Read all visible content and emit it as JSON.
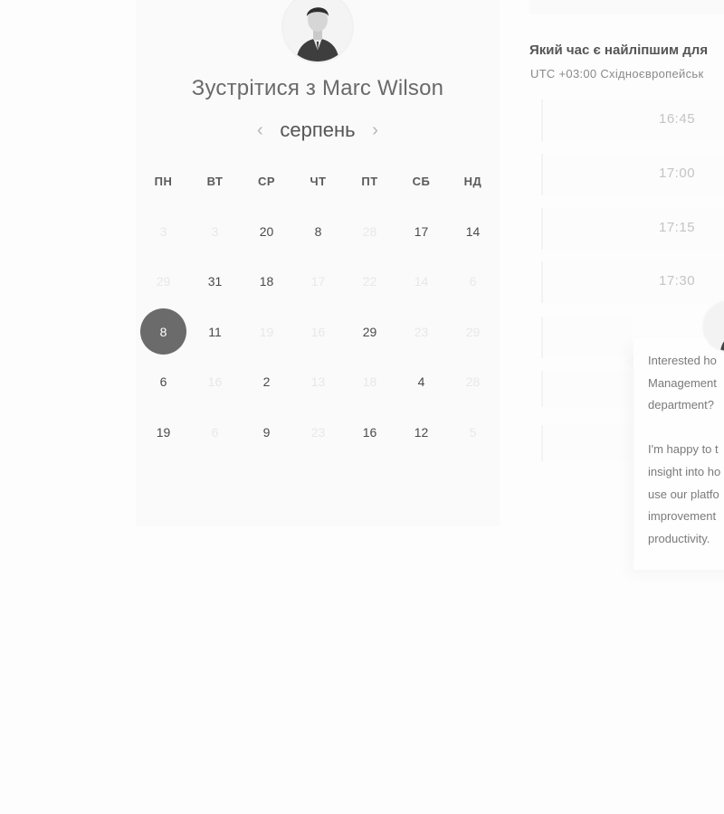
{
  "host": {
    "title": "Зустрітися з Marc Wilson"
  },
  "calendar": {
    "month": "серпень",
    "weekdays": [
      "ПН",
      "ВТ",
      "СР",
      "ЧТ",
      "ПТ",
      "СБ",
      "НД"
    ],
    "rows": [
      [
        {
          "d": "3",
          "s": "dim"
        },
        {
          "d": "3",
          "s": "dim"
        },
        {
          "d": "20",
          "s": "on"
        },
        {
          "d": "8",
          "s": "on"
        },
        {
          "d": "28",
          "s": "dim"
        },
        {
          "d": "17",
          "s": "on"
        },
        {
          "d": "14",
          "s": "on"
        }
      ],
      [
        {
          "d": "29",
          "s": "dim"
        },
        {
          "d": "31",
          "s": "on"
        },
        {
          "d": "18",
          "s": "on"
        },
        {
          "d": "17",
          "s": "dim"
        },
        {
          "d": "22",
          "s": "dim"
        },
        {
          "d": "14",
          "s": "dim"
        },
        {
          "d": "6",
          "s": "dim"
        }
      ],
      [
        {
          "d": "8",
          "s": "sel"
        },
        {
          "d": "11",
          "s": "on"
        },
        {
          "d": "19",
          "s": "dim"
        },
        {
          "d": "16",
          "s": "dim"
        },
        {
          "d": "29",
          "s": "on"
        },
        {
          "d": "23",
          "s": "dim"
        },
        {
          "d": "29",
          "s": "dim"
        }
      ],
      [
        {
          "d": "6",
          "s": "on"
        },
        {
          "d": "16",
          "s": "dim"
        },
        {
          "d": "2",
          "s": "on"
        },
        {
          "d": "13",
          "s": "dim"
        },
        {
          "d": "18",
          "s": "dim"
        },
        {
          "d": "4",
          "s": "on"
        },
        {
          "d": "28",
          "s": "dim"
        }
      ],
      [
        {
          "d": "19",
          "s": "on"
        },
        {
          "d": "6",
          "s": "dim"
        },
        {
          "d": "9",
          "s": "on"
        },
        {
          "d": "23",
          "s": "dim"
        },
        {
          "d": "16",
          "s": "on"
        },
        {
          "d": "12",
          "s": "on"
        },
        {
          "d": "5",
          "s": "dim"
        }
      ]
    ]
  },
  "tabs": {
    "left": "...",
    "right": "..."
  },
  "schedule": {
    "question": "Який час є найліпшим для",
    "timezone": "UTC +03:00 Східноєвропейськ",
    "slots": [
      "16:45",
      "17:00",
      "17:15",
      "17:30"
    ]
  },
  "popup": {
    "lines": [
      "Interested ho",
      "Management",
      "department?",
      "",
      "I'm happy to t",
      "insight into ho",
      "use our platfo",
      "improvement",
      "productivity."
    ]
  }
}
